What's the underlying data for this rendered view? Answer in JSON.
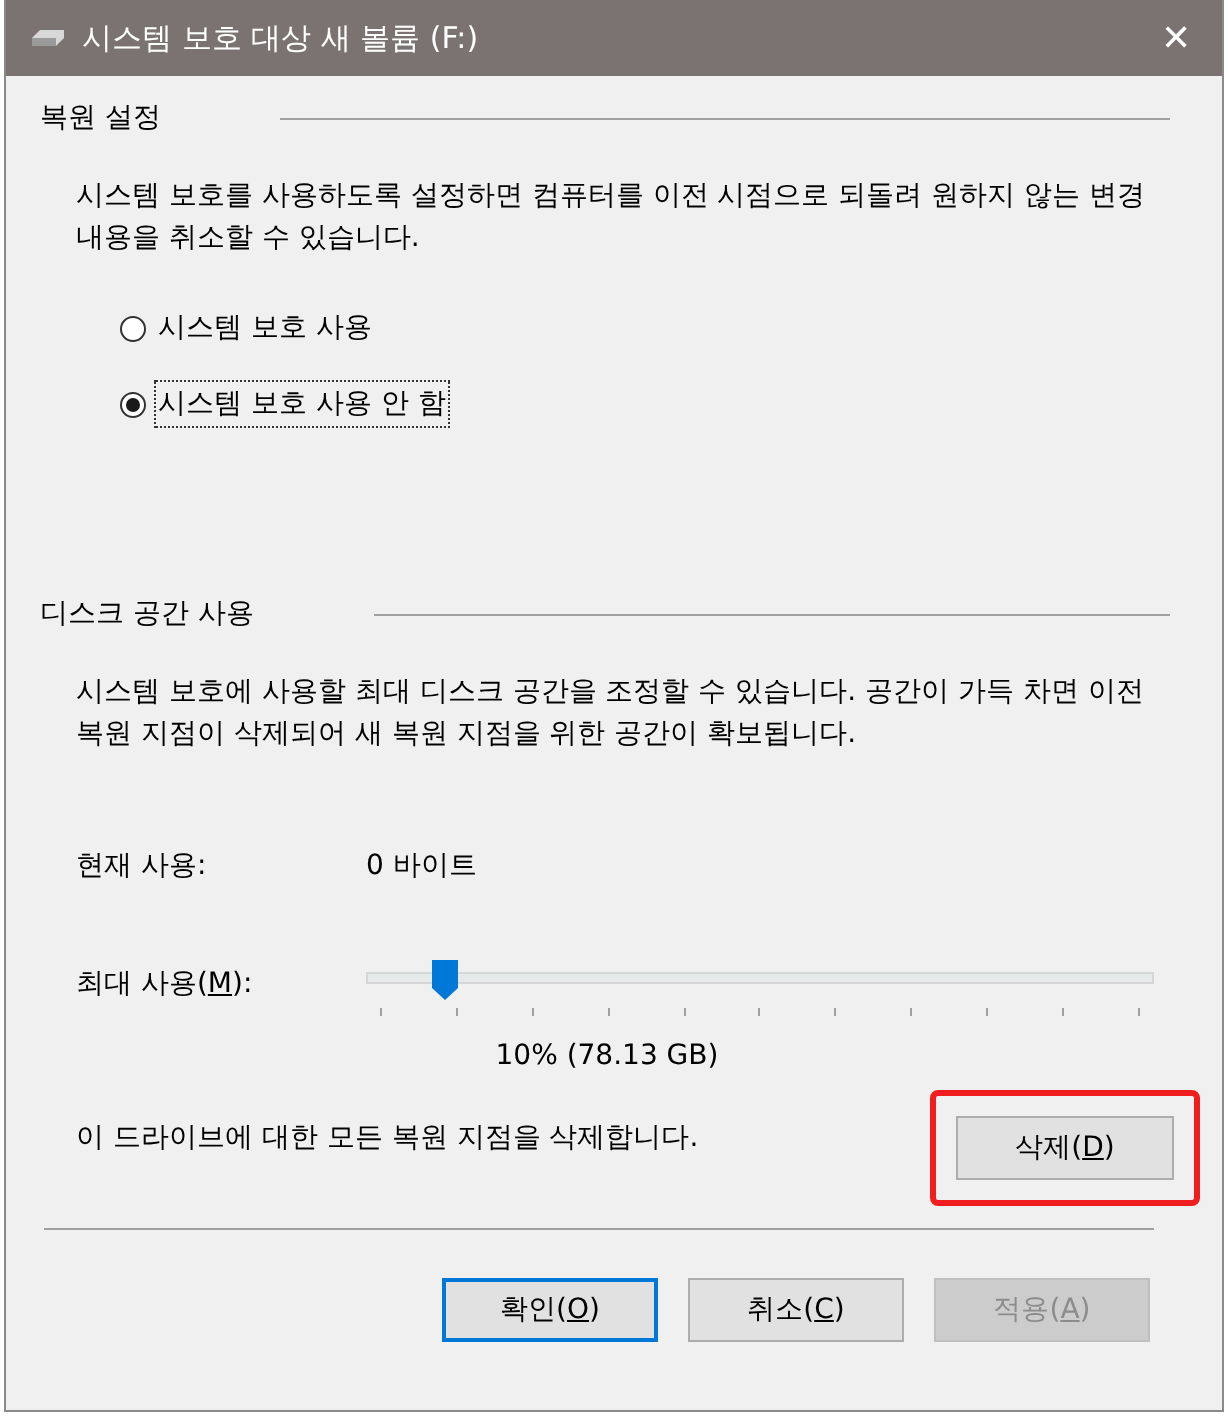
{
  "window": {
    "title": "시스템 보호 대상 새 볼륨 (F:)",
    "close": "✕"
  },
  "restore_settings": {
    "heading": "복원 설정",
    "description": "시스템 보호를 사용하도록 설정하면 컴퓨터를 이전 시점으로 되돌려 원하지 않는 변경 내용을 취소할 수 있습니다.",
    "options": [
      {
        "label": "시스템 보호 사용",
        "selected": false,
        "focused": false
      },
      {
        "label": "시스템 보호 사용 안 함",
        "selected": true,
        "focused": true
      }
    ]
  },
  "disk_space": {
    "heading": "디스크 공간 사용",
    "description": "시스템 보호에 사용할 최대 디스크 공간을 조정할 수 있습니다. 공간이 가득 차면 이전 복원 지점이 삭제되어 새 복원 지점을 위한 공간이 확보됩니다.",
    "current_label": "현재 사용:",
    "current_value": "0 바이트",
    "max_label": {
      "before": "최대 사용(",
      "key": "M",
      "after": "):"
    },
    "slider": {
      "level": 0.1
    },
    "reading": "10% (78.13 GB)",
    "delete_text": "이 드라이브에 대한 모든 복원 지점을 삭제합니다.",
    "delete_button": {
      "before": "삭제(",
      "key": "D",
      "after": ")",
      "highlighted": true
    }
  },
  "buttons": [
    {
      "before": "확인(",
      "key": "O",
      "after": ")",
      "default": true,
      "disabled": false
    },
    {
      "before": "취소(",
      "key": "C",
      "after": ")",
      "default": false,
      "disabled": false
    },
    {
      "before": "적용(",
      "key": "A",
      "after": ")",
      "default": false,
      "disabled": true
    }
  ]
}
